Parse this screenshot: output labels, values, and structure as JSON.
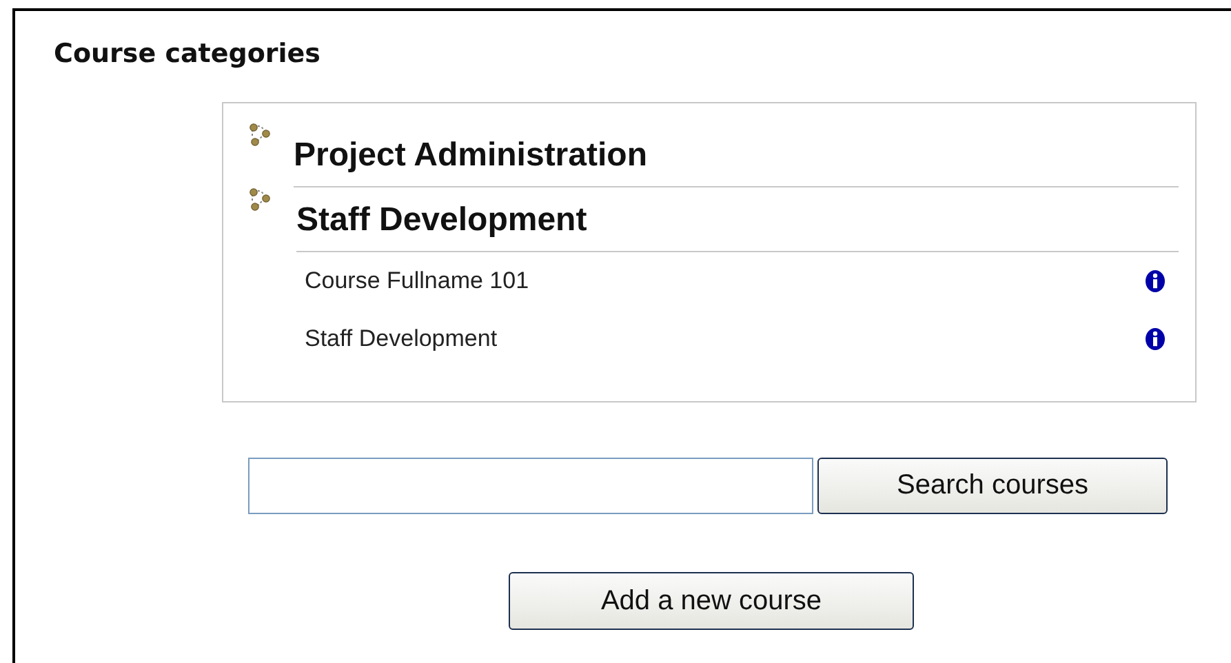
{
  "title": "Course categories",
  "categories": [
    {
      "name": "Project Administration"
    },
    {
      "name": "Staff Development",
      "courses": [
        {
          "name": "Course Fullname 101"
        },
        {
          "name": "Staff Development"
        }
      ]
    }
  ],
  "search": {
    "button": "Search courses"
  },
  "add_button": "Add a new course"
}
